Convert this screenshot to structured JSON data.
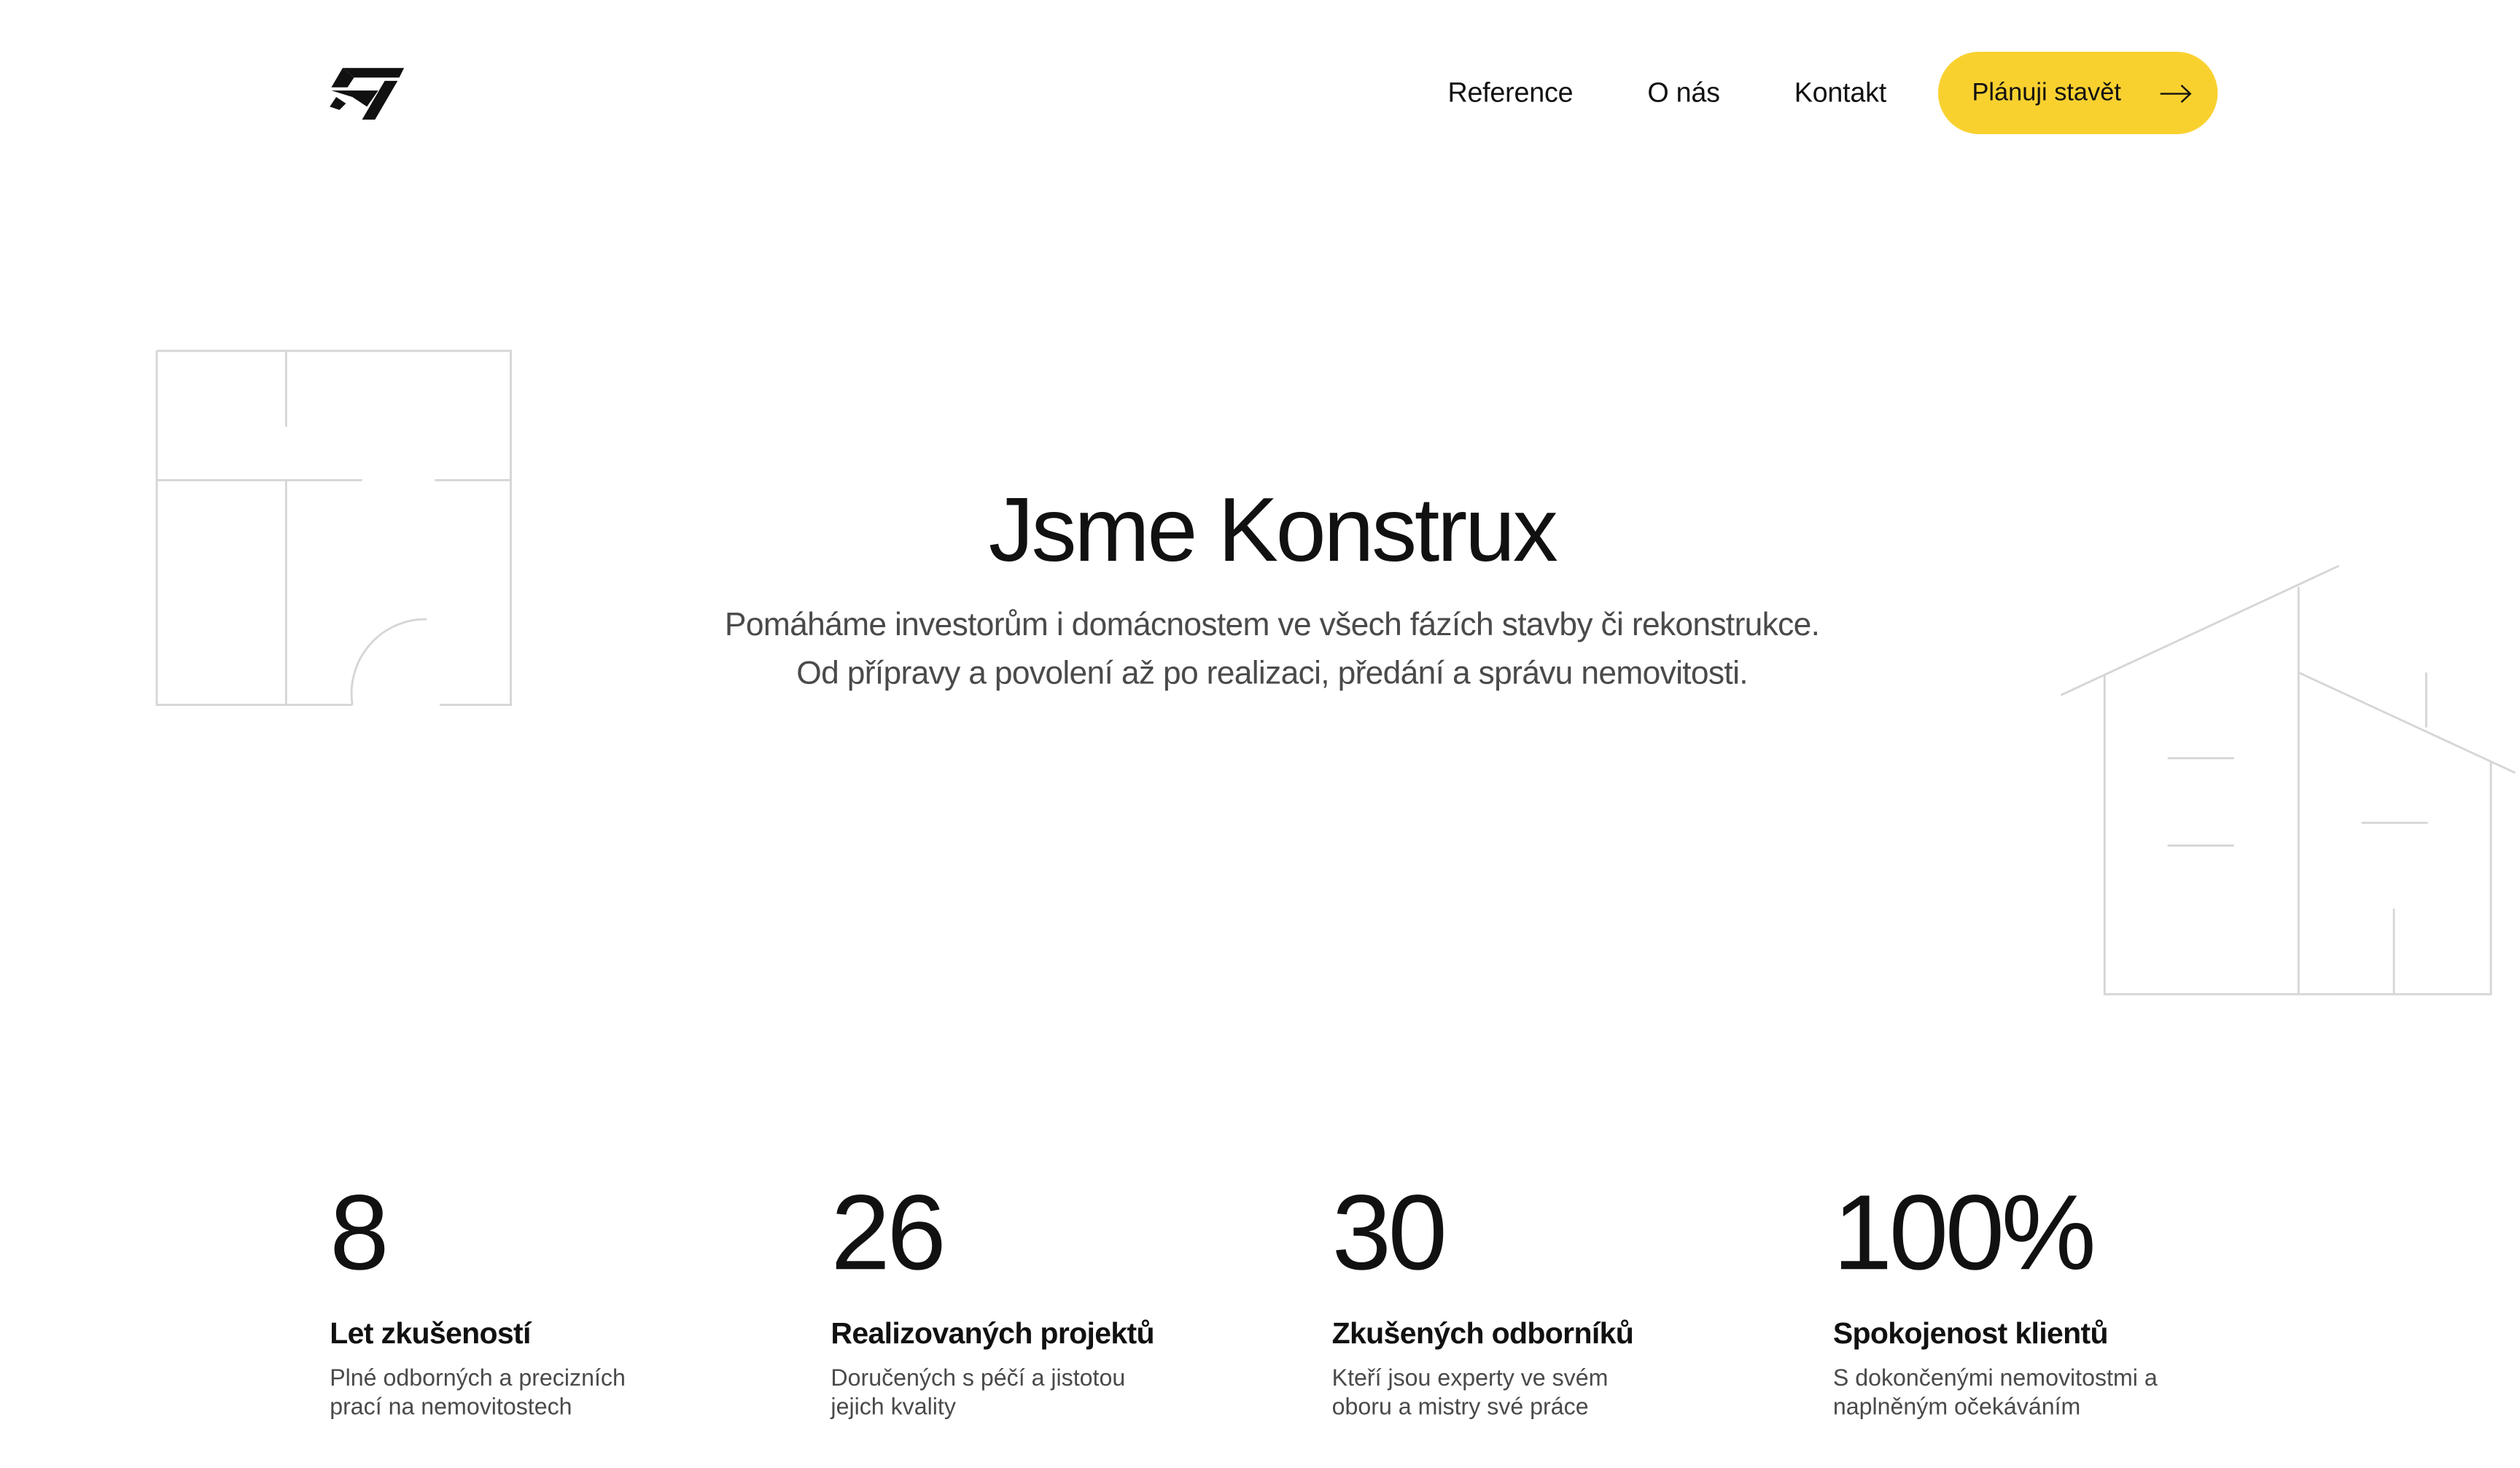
{
  "header": {
    "logo_icon": "konstrux-logo-icon",
    "nav": [
      {
        "label": "Reference"
      },
      {
        "label": "O nás"
      },
      {
        "label": "Kontakt"
      }
    ],
    "cta": {
      "label": "Plánuji stavět",
      "icon": "arrow-right-icon",
      "color": "#f9d12f"
    }
  },
  "hero": {
    "title": "Jsme Konstrux",
    "line1": "Pomáháme investorům i domácnostem ve všech fázích stavby či rekonstrukce.",
    "line2": "Od přípravy a povolení až po realizaci, předání a správu nemovitosti."
  },
  "stats": [
    {
      "value": "8",
      "title": "Let zkušeností",
      "desc": "Plné odborných a precizních prací na nemovitostech"
    },
    {
      "value": "26",
      "title": "Realizovaných projektů",
      "desc": "Doručených s péčí a jistotou jejich kvality"
    },
    {
      "value": "30",
      "title": "Zkušených odborníků",
      "desc": "Kteří jsou experty ve svém oboru a mistry své práce"
    },
    {
      "value": "100%",
      "title": "Spokojenost klientů",
      "desc": "S dokončenými nemovitostmi a naplněným očekáváním"
    }
  ],
  "decorations": {
    "left": "floorplan-illustration",
    "right": "house-outline-illustration",
    "line_color": "#d6d6d6"
  }
}
